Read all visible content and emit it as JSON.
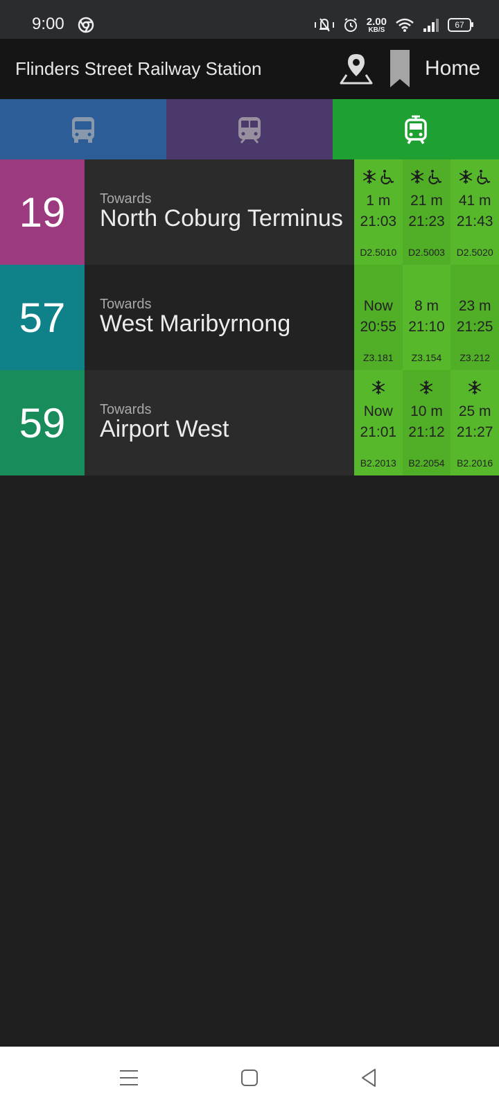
{
  "status_bar": {
    "time": "9:00",
    "speed_value": "2.00",
    "speed_unit": "KB/S",
    "battery": "67",
    "icons": [
      "chrome-icon",
      "vibrate-icon",
      "alarm-icon",
      "wifi-icon",
      "signal-icon",
      "battery-icon"
    ]
  },
  "header": {
    "title": "Flinders Street Railway Station",
    "home_label": "Home",
    "icons": [
      "map-pin-icon",
      "bookmark-icon"
    ]
  },
  "tabs": [
    {
      "name": "bus",
      "icon": "bus-icon",
      "color": "#2c5d96"
    },
    {
      "name": "train",
      "icon": "train-icon",
      "color": "#4c396b"
    },
    {
      "name": "tram",
      "icon": "tram-icon",
      "color": "#1fa032",
      "selected": true
    }
  ],
  "routes": [
    {
      "number": "19",
      "color": "#9c3a7f",
      "info_bg": "#2b2b2b",
      "towards_label": "Towards",
      "destination": "North Coburg Terminus",
      "departures": [
        {
          "mins": "1 m",
          "time": "21:03",
          "vehicle": "D2.5010",
          "ac": true,
          "accessible": true,
          "bg": "#57b82b"
        },
        {
          "mins": "21 m",
          "time": "21:23",
          "vehicle": "D2.5003",
          "ac": true,
          "accessible": true,
          "bg": "#50ae27"
        },
        {
          "mins": "41 m",
          "time": "21:43",
          "vehicle": "D2.5020",
          "ac": true,
          "accessible": true,
          "bg": "#57b82b"
        }
      ]
    },
    {
      "number": "57",
      "color": "#0f8189",
      "info_bg": "#222222",
      "towards_label": "Towards",
      "destination": "West Maribyrnong",
      "departures": [
        {
          "mins": "Now",
          "time": "20:55",
          "vehicle": "Z3.181",
          "ac": false,
          "accessible": false,
          "bg": "#50ae27"
        },
        {
          "mins": "8 m",
          "time": "21:10",
          "vehicle": "Z3.154",
          "ac": false,
          "accessible": false,
          "bg": "#57b82b"
        },
        {
          "mins": "23 m",
          "time": "21:25",
          "vehicle": "Z3.212",
          "ac": false,
          "accessible": false,
          "bg": "#50ae27"
        }
      ]
    },
    {
      "number": "59",
      "color": "#188c5b",
      "info_bg": "#2b2b2b",
      "towards_label": "Towards",
      "destination": "Airport West",
      "departures": [
        {
          "mins": "Now",
          "time": "21:01",
          "vehicle": "B2.2013",
          "ac": true,
          "accessible": false,
          "bg": "#57b82b"
        },
        {
          "mins": "10 m",
          "time": "21:12",
          "vehicle": "B2.2054",
          "ac": true,
          "accessible": false,
          "bg": "#50ae27"
        },
        {
          "mins": "25 m",
          "time": "21:27",
          "vehicle": "B2.2016",
          "ac": true,
          "accessible": false,
          "bg": "#57b82b"
        }
      ]
    }
  ],
  "nav_bar": {
    "icons": [
      "menu-icon",
      "home-square-icon",
      "back-icon"
    ]
  }
}
